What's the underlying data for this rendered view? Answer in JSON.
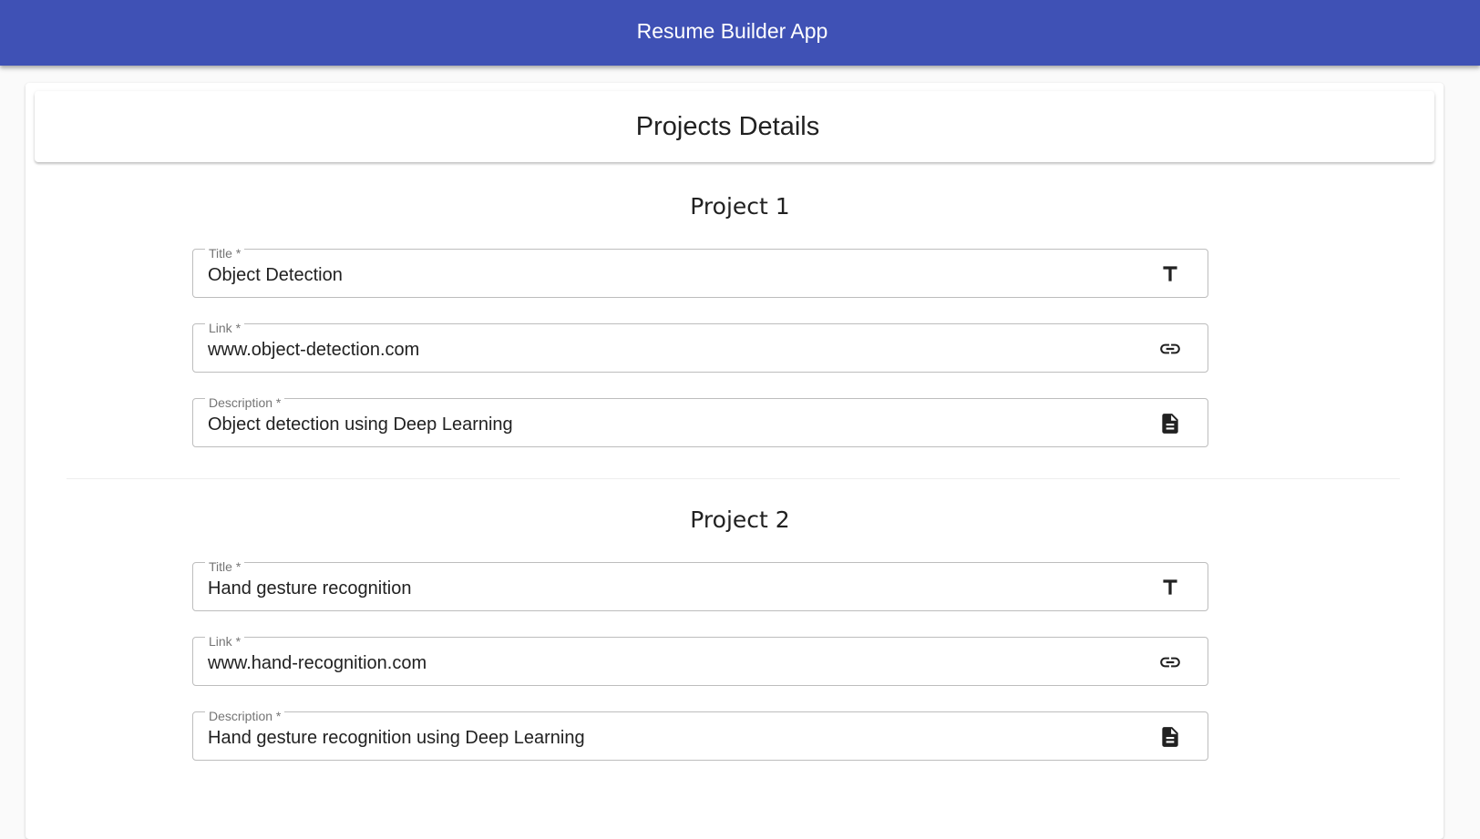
{
  "appbar": {
    "title": "Resume Builder App"
  },
  "section": {
    "title": "Projects Details"
  },
  "projects": [
    {
      "heading": "Project 1",
      "title": {
        "label": "Title *",
        "value": "Object Detection",
        "icon": "title-icon"
      },
      "link": {
        "label": "Link *",
        "value": "www.object-detection.com",
        "icon": "link-icon"
      },
      "description": {
        "label": "Description *",
        "value": "Object detection using Deep Learning",
        "icon": "description-icon"
      }
    },
    {
      "heading": "Project 2",
      "title": {
        "label": "Title *",
        "value": "Hand gesture recognition",
        "icon": "title-icon"
      },
      "link": {
        "label": "Link *",
        "value": "www.hand-recognition.com",
        "icon": "link-icon"
      },
      "description": {
        "label": "Description *",
        "value": "Hand gesture recognition using Deep Learning",
        "icon": "description-icon"
      }
    }
  ],
  "colors": {
    "appbar": "#3f51b5",
    "field_border": "#bdbdbd",
    "label": "#757575"
  }
}
